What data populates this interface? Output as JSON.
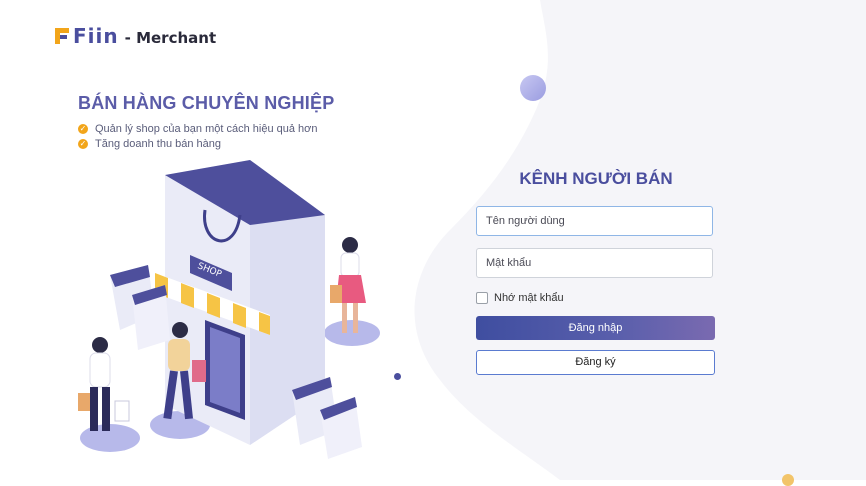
{
  "brand": {
    "name": "Fiin",
    "suffix": "- Merchant"
  },
  "promo": {
    "headline": "BÁN HÀNG CHUYÊN NGHIỆP",
    "bullets": [
      "Quản lý shop của bạn một cách hiệu quả hơn",
      "Tăng doanh thu bán hàng"
    ],
    "illustration_sign": "SHOP"
  },
  "form": {
    "title": "KÊNH NGƯỜI BÁN",
    "username_placeholder": "Tên người dùng",
    "password_placeholder": "Mật khẩu",
    "remember_label": "Nhớ mật khẩu",
    "login_label": "Đăng nhập",
    "register_label": "Đăng ký"
  },
  "colors": {
    "accent": "#4a4e9e",
    "check": "#f2a51a",
    "background_panel": "#f5f5f9"
  },
  "icons": {
    "bullet": "check-circle-icon"
  }
}
